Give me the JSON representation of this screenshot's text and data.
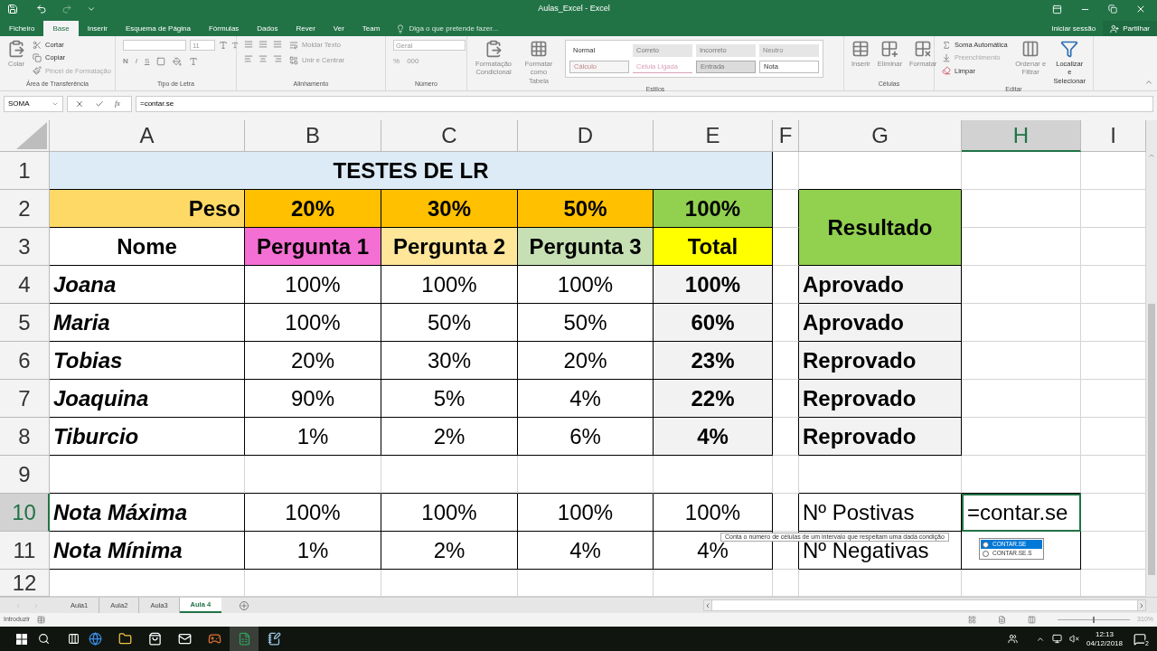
{
  "title_bar": {
    "title": "Aulas_Excel - Excel"
  },
  "menu_tabs": [
    {
      "label": "Ficheiro",
      "selected": false
    },
    {
      "label": "Base",
      "selected": true
    },
    {
      "label": "Inserir",
      "selected": false
    },
    {
      "label": "Esquema de Página",
      "selected": false
    },
    {
      "label": "Fórmulas",
      "selected": false
    },
    {
      "label": "Dados",
      "selected": false
    },
    {
      "label": "Rever",
      "selected": false
    },
    {
      "label": "Ver",
      "selected": false
    },
    {
      "label": "Team",
      "selected": false
    }
  ],
  "tell_me": {
    "placeholder": "Diga o que pretende fazer..."
  },
  "account": {
    "sign_in": "Iniciar sessão",
    "share": "Partilhar"
  },
  "ribbon": {
    "groups": [
      {
        "name": "Área de Transferência",
        "items": [
          {
            "kind": "large",
            "label": "Colar"
          },
          {
            "kind": "stack",
            "labels": [
              "Cortar",
              "Copiar",
              "Pincel de Formatação"
            ]
          }
        ]
      },
      {
        "name": "Tipo de Letra",
        "items": [
          {
            "kind": "font",
            "size": "11",
            "styles": [
              "N",
              "I",
              "S"
            ]
          }
        ]
      },
      {
        "name": "Alinhamento",
        "items": [
          {
            "kind": "align",
            "labels": [
              "Moldar Texto",
              "Unir e Centrar"
            ]
          }
        ]
      },
      {
        "name": "Número",
        "items": [
          {
            "kind": "number",
            "format": "Geral",
            "symbols": [
              "%",
              "000"
            ]
          }
        ]
      },
      {
        "name": "Estilos",
        "items": [
          {
            "kind": "large",
            "label": "Formatação Condicional"
          },
          {
            "kind": "large",
            "label": "Formatar como Tabela"
          },
          {
            "kind": "gallery",
            "styles": [
              "Normal",
              "Correto",
              "Incorreto",
              "Neutro",
              "Cálculo",
              "Célula Ligada",
              "Entrada",
              "Nota"
            ]
          }
        ]
      },
      {
        "name": "Células",
        "items": [
          {
            "kind": "large",
            "label": "Inserir"
          },
          {
            "kind": "large",
            "label": "Eliminar"
          },
          {
            "kind": "large",
            "label": "Formatar"
          }
        ]
      },
      {
        "name": "Editar",
        "items": [
          {
            "kind": "stack",
            "labels": [
              "Soma Automática",
              "Preenchimento",
              "Limpar"
            ]
          },
          {
            "kind": "large",
            "label": "Ordenar e Filtrar"
          },
          {
            "kind": "large",
            "label": "Localizar e Selecionar"
          }
        ]
      }
    ]
  },
  "formula_bar": {
    "name_box": "SOMA",
    "function_label": "fx",
    "formula": "=contar.se"
  },
  "sheet": {
    "columns": [
      {
        "label": "A",
        "selected": false
      },
      {
        "label": "B",
        "selected": false
      },
      {
        "label": "C",
        "selected": false
      },
      {
        "label": "D",
        "selected": false
      },
      {
        "label": "E",
        "selected": false
      },
      {
        "label": "F",
        "selected": false
      },
      {
        "label": "G",
        "selected": false
      },
      {
        "label": "H",
        "selected": true
      },
      {
        "label": "I",
        "selected": false
      }
    ],
    "rows": [
      {
        "label": "1",
        "selected": false,
        "cells": {
          "A": "TESTES DE LR"
        }
      },
      {
        "label": "2",
        "selected": false,
        "cells": {
          "A": "Peso",
          "B": "20%",
          "C": "30%",
          "D": "50%",
          "E": "100%",
          "G": "Resultado"
        }
      },
      {
        "label": "3",
        "selected": false,
        "cells": {
          "A": "Nome",
          "B": "Pergunta 1",
          "C": "Pergunta 2",
          "D": "Pergunta 3",
          "E": "Total"
        }
      },
      {
        "label": "4",
        "selected": false,
        "cells": {
          "A": "Joana",
          "B": "100%",
          "C": "100%",
          "D": "100%",
          "E": "100%",
          "G": "Aprovado"
        }
      },
      {
        "label": "5",
        "selected": false,
        "cells": {
          "A": "Maria",
          "B": "100%",
          "C": "50%",
          "D": "50%",
          "E": "60%",
          "G": "Aprovado"
        }
      },
      {
        "label": "6",
        "selected": false,
        "cells": {
          "A": "Tobias",
          "B": "20%",
          "C": "30%",
          "D": "20%",
          "E": "23%",
          "G": "Reprovado"
        }
      },
      {
        "label": "7",
        "selected": false,
        "cells": {
          "A": "Joaquina",
          "B": "90%",
          "C": "5%",
          "D": "4%",
          "E": "22%",
          "G": "Reprovado"
        }
      },
      {
        "label": "8",
        "selected": false,
        "cells": {
          "A": "Tiburcio",
          "B": "1%",
          "C": "2%",
          "D": "6%",
          "E": "4%",
          "G": "Reprovado"
        }
      },
      {
        "label": "9",
        "selected": false,
        "cells": {}
      },
      {
        "label": "10",
        "selected": true,
        "cells": {
          "A": "Nota Máxima",
          "B": "100%",
          "C": "100%",
          "D": "100%",
          "E": "100%",
          "G": "Nº Postivas",
          "H": "=contar.se"
        }
      },
      {
        "label": "11",
        "selected": false,
        "cells": {
          "A": "Nota Mínima",
          "B": "1%",
          "C": "2%",
          "D": "4%",
          "E": "4%",
          "G": "Nº Negativas"
        }
      },
      {
        "label": "12",
        "selected": false,
        "cells": {}
      }
    ]
  },
  "autocomplete": {
    "tooltip": "Conta o número de células de um intervalo que respeitam uma dada condição",
    "items": [
      {
        "label": "CONTAR.SE",
        "selected": true
      },
      {
        "label": "CONTAR.SE.S",
        "selected": false
      }
    ]
  },
  "sheet_tabs": [
    {
      "label": "Aula1",
      "selected": false
    },
    {
      "label": "Aula2",
      "selected": false
    },
    {
      "label": "Aula3",
      "selected": false
    },
    {
      "label": "Aula 4",
      "selected": true
    }
  ],
  "status_bar": {
    "mode": "Introduzir",
    "zoom_slider": {
      "level": 0.5
    },
    "zoom": "310%"
  },
  "taskbar": {
    "time": "12:13",
    "date": "04/12/2018",
    "notifications": "2"
  }
}
